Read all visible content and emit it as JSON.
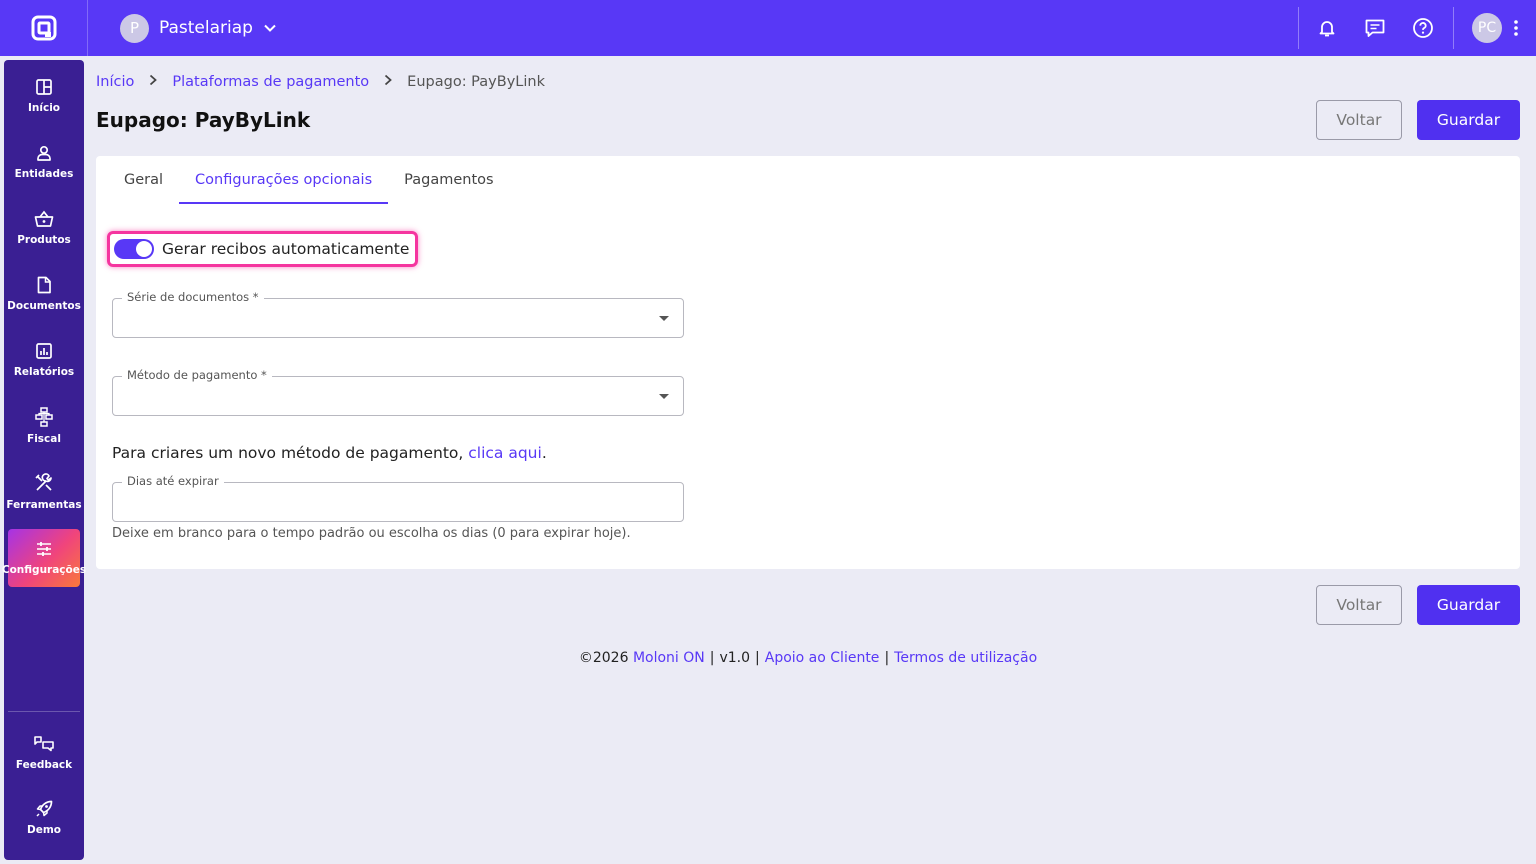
{
  "topbar": {
    "company_initial": "P",
    "company_name": "Pastelariap",
    "user_initials": "PC"
  },
  "sidebar": {
    "items": [
      {
        "label": "Início",
        "icon": "grid-icon"
      },
      {
        "label": "Entidades",
        "icon": "user-icon"
      },
      {
        "label": "Produtos",
        "icon": "basket-icon"
      },
      {
        "label": "Documentos",
        "icon": "document-icon"
      },
      {
        "label": "Relatórios",
        "icon": "chart-icon"
      },
      {
        "label": "Fiscal",
        "icon": "hierarchy-icon"
      },
      {
        "label": "Ferramentas",
        "icon": "tools-icon"
      },
      {
        "label": "Configurações",
        "icon": "sliders-icon",
        "active": true
      }
    ],
    "bottom": [
      {
        "label": "Feedback",
        "icon": "feedback-icon"
      },
      {
        "label": "Demo",
        "icon": "rocket-icon"
      }
    ]
  },
  "breadcrumb": {
    "home": "Início",
    "parent": "Plataformas de pagamento",
    "current": "Eupago: PayByLink"
  },
  "page": {
    "title": "Eupago: PayByLink",
    "back_label": "Voltar",
    "save_label": "Guardar"
  },
  "tabs": [
    {
      "label": "Geral"
    },
    {
      "label": "Configurações opcionais",
      "active": true
    },
    {
      "label": "Pagamentos"
    }
  ],
  "form": {
    "auto_receipts_label": "Gerar recibos automaticamente",
    "auto_receipts_on": true,
    "document_series_label": "Série de documentos *",
    "document_series_value": "",
    "payment_method_label": "Método de pagamento *",
    "payment_method_value": "",
    "new_method_text": "Para criares um novo método de pagamento, ",
    "new_method_link": "clica aqui",
    "new_method_suffix": ".",
    "days_label": "Dias até expirar",
    "days_value": "",
    "days_hint": "Deixe em branco para o tempo padrão ou escolha os dias (0 para expirar hoje)."
  },
  "footer": {
    "copyright": "©2026",
    "brand": "Moloni ON",
    "version": "v1.0",
    "support": "Apoio ao Cliente",
    "terms": "Termos de utilização"
  },
  "colors": {
    "brand": "#5838f6",
    "sidebar": "#3a1f93",
    "highlight": "#f5359f"
  }
}
